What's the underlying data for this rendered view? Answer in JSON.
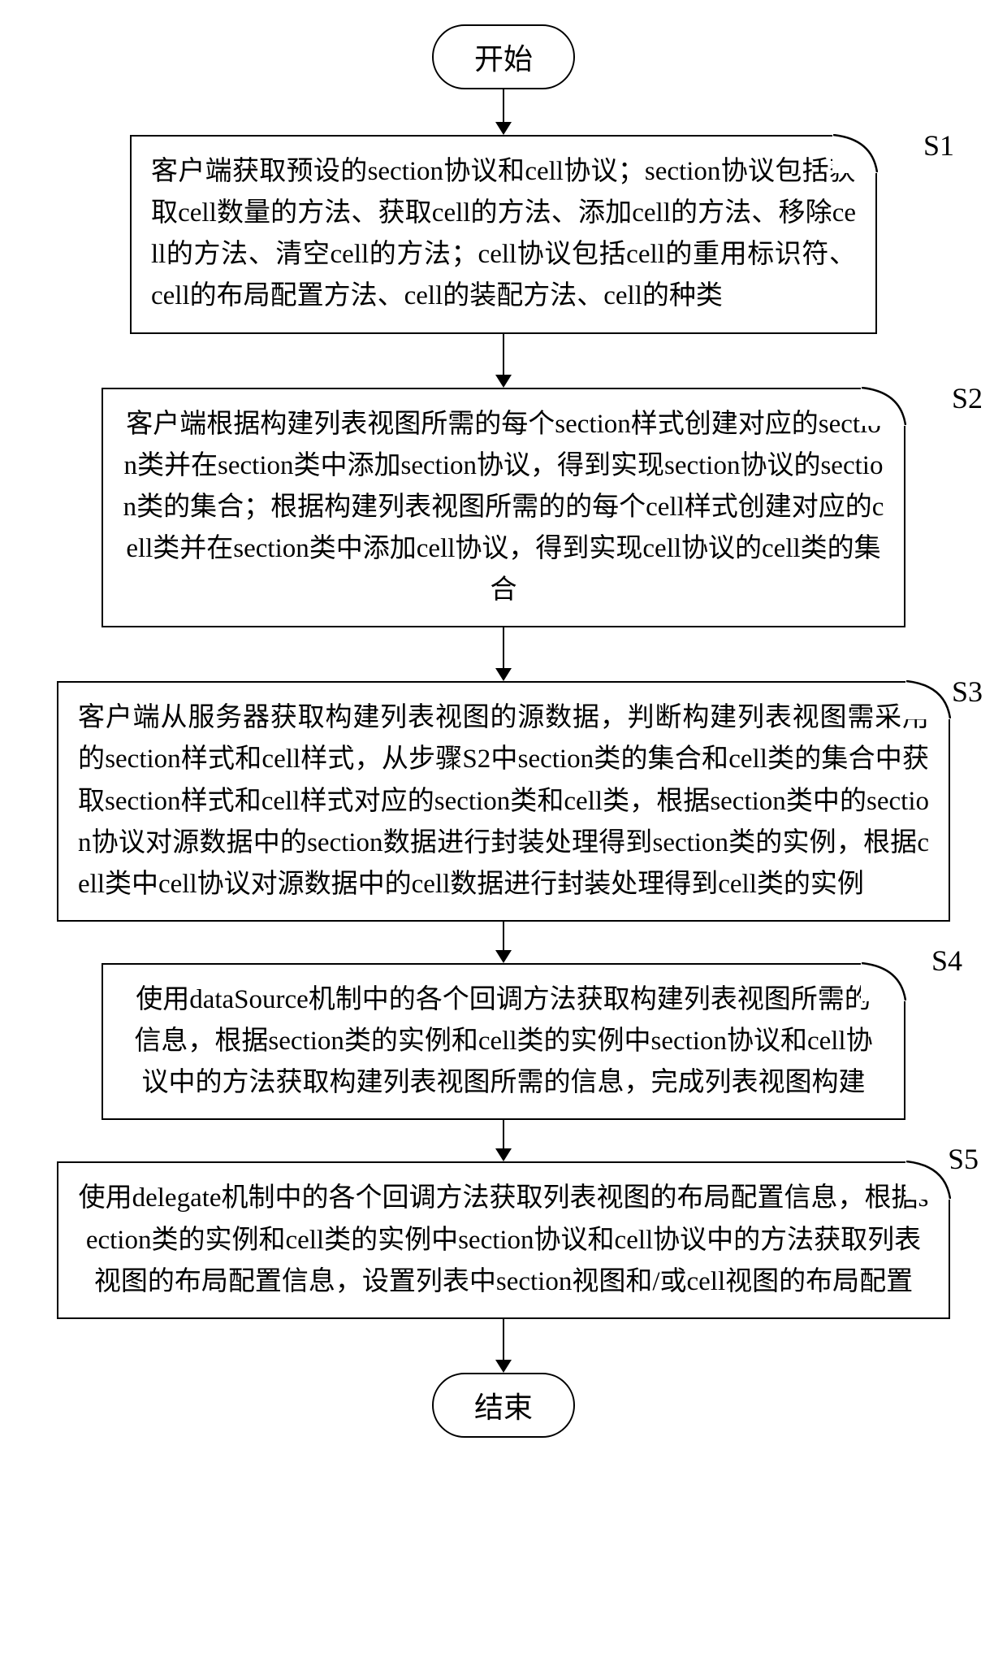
{
  "terminals": {
    "start": "开始",
    "end": "结束"
  },
  "steps": [
    {
      "id": "S1",
      "text": "客户端获取预设的section协议和cell协议；section协议包括获取cell数量的方法、获取cell的方法、添加cell的方法、移除cell的方法、清空cell的方法；cell协议包括cell的重用标识符、cell的布局配置方法、cell的装配方法、cell的种类"
    },
    {
      "id": "S2",
      "text": "客户端根据构建列表视图所需的每个section样式创建对应的section类并在section类中添加section协议，得到实现section协议的section类的集合；根据构建列表视图所需的的每个cell样式创建对应的cell类并在section类中添加cell协议，得到实现cell协议的cell类的集合"
    },
    {
      "id": "S3",
      "text": "客户端从服务器获取构建列表视图的源数据，判断构建列表视图需采用的section样式和cell样式，从步骤S2中section类的集合和cell类的集合中获取section样式和cell样式对应的section类和cell类，根据section类中的section协议对源数据中的section数据进行封装处理得到section类的实例，根据cell类中cell协议对源数据中的cell数据进行封装处理得到cell类的实例"
    },
    {
      "id": "S4",
      "text": "使用dataSource机制中的各个回调方法获取构建列表视图所需的信息，根据section类的实例和cell类的实例中section协议和cell协议中的方法获取构建列表视图所需的信息，完成列表视图构建"
    },
    {
      "id": "S5",
      "text": "使用delegate机制中的各个回调方法获取列表视图的布局配置信息，根据section类的实例和cell类的实例中section协议和cell协议中的方法获取列表视图的布局配置信息，设置列表中section视图和/或cell视图的布局配置"
    }
  ]
}
